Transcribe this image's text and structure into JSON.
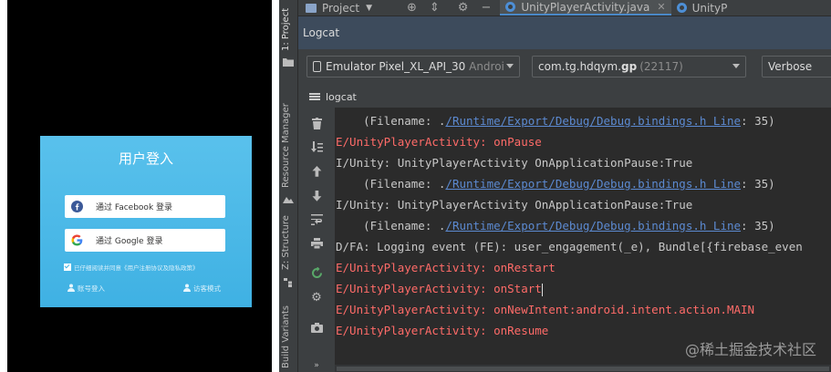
{
  "login": {
    "title": "用户登入",
    "facebook_btn": "通过 Facebook 登录",
    "google_btn": "通过 Google 登录",
    "agree_prefix": "已仔细阅读并同意",
    "agree_link": "《用户注册协议及隐私政策》",
    "account_login": "账号登入",
    "guest_mode": "访客模式"
  },
  "ide": {
    "side_tabs": {
      "project": "1: Project",
      "resource_manager": "Resource Manager",
      "structure": "Z: Structure",
      "build_variants": "Build Variants"
    },
    "topbar": {
      "project_label": "Project",
      "tabs": [
        {
          "label": "UnityPlayerActivity.java",
          "active": true
        },
        {
          "label": "UnityP",
          "active": false
        }
      ]
    },
    "panel_title": "Logcat",
    "device": {
      "name": "Emulator Pixel_XL_API_30",
      "suffix": "Androi"
    },
    "process": {
      "name": "com.tg.hdqym.",
      "name_bold": "gp",
      "pid": "(22117)"
    },
    "log_level": "Verbose",
    "sub_title": "logcat",
    "log_lines": [
      {
        "level": "i",
        "pre": "    (Filename: .",
        "link": "/Runtime/Export/Debug/Debug.bindings.h Line",
        "post": ": 35)"
      },
      {
        "level": "e",
        "pre": "E/UnityPlayerActivity: onPause",
        "link": "",
        "post": ""
      },
      {
        "level": "i",
        "pre": "I/Unity: UnityPlayerActivity OnApplicationPause:True",
        "link": "",
        "post": ""
      },
      {
        "level": "i",
        "pre": "    (Filename: .",
        "link": "/Runtime/Export/Debug/Debug.bindings.h Line",
        "post": ": 35)"
      },
      {
        "level": "i",
        "pre": "I/Unity: UnityPlayerActivity OnApplicationPause:True",
        "link": "",
        "post": ""
      },
      {
        "level": "i",
        "pre": "    (Filename: .",
        "link": "/Runtime/Export/Debug/Debug.bindings.h Line",
        "post": ": 35)"
      },
      {
        "level": "d",
        "pre": "D/FA: Logging event (FE): user_engagement(_e), Bundle[{firebase_even",
        "link": "",
        "post": ""
      },
      {
        "level": "e",
        "pre": "E/UnityPlayerActivity: onRestart",
        "link": "",
        "post": ""
      },
      {
        "level": "e",
        "pre": "E/UnityPlayerActivity: onStart",
        "link": "",
        "post": "",
        "caret": true
      },
      {
        "level": "e",
        "pre": "E/UnityPlayerActivity: onNewIntent:android.intent.action.MAIN",
        "link": "",
        "post": ""
      },
      {
        "level": "e",
        "pre": "E/UnityPlayerActivity: onResume",
        "link": "",
        "post": ""
      }
    ],
    "watermark": "@稀土掘金技术社区"
  },
  "colors": {
    "error": "#ff6b68",
    "info": "#c8c8c8",
    "link": "#5c8ad1",
    "login_bg": "#4ab8e8",
    "logcat_header": "#3d4b5c"
  },
  "icons": [
    "facebook-icon",
    "google-icon",
    "user-icon",
    "guest-icon",
    "folder-icon",
    "target-icon",
    "collapse-icon",
    "gear-icon",
    "minimize-icon",
    "java-class-icon",
    "close-icon",
    "device-icon",
    "trash-icon",
    "soft-wrap-icon",
    "up-arrow-icon",
    "down-arrow-icon",
    "print-icon",
    "restart-icon",
    "camera-icon",
    "more-icon"
  ]
}
